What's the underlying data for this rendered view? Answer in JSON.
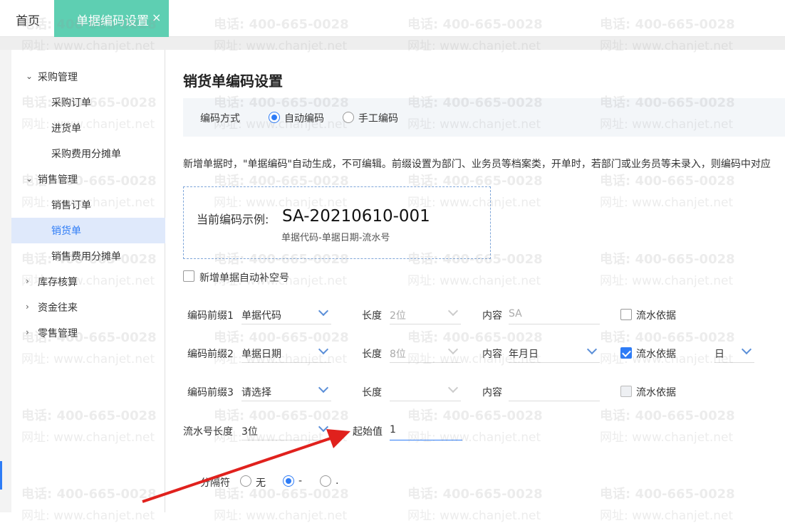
{
  "tabs": {
    "home": "首页",
    "active": "单据编码设置",
    "close": "×"
  },
  "sidebar": {
    "groups": [
      {
        "label": "采购管理",
        "items": [
          "采购订单",
          "进货单",
          "采购费用分摊单"
        ]
      },
      {
        "label": "销售管理",
        "items": [
          "销售订单",
          "销货单",
          "销售费用分摊单"
        ]
      },
      {
        "label": "库存核算"
      },
      {
        "label": "资金往来"
      },
      {
        "label": "零售管理"
      }
    ],
    "active_item": "销货单"
  },
  "main": {
    "title": "销货单编码设置",
    "mode": {
      "label": "编码方式",
      "auto": "自动编码",
      "manual": "手工编码",
      "selected": "自动编码"
    },
    "description": "新增单据时，\"单据编码\"自动生成，不可编辑。前缀设置为部门、业务员等档案类，开单时，若部门或业务员等未录入，则编码中对应",
    "example": {
      "label": "当前编码示例:",
      "code": "SA-20210610-001",
      "format": "单据代码-单据日期-流水号"
    },
    "auto_fill_label": "新增单据自动补空号",
    "prefix_rows": [
      {
        "label": "编码前缀1",
        "type": "单据代码",
        "length_label": "长度",
        "length": "2位",
        "content_label": "内容",
        "content": "SA",
        "serial_label": "流水依据",
        "serial_checked": false
      },
      {
        "label": "编码前缀2",
        "type": "单据日期",
        "length_label": "长度",
        "length": "8位",
        "content_label": "内容",
        "content": "年月日",
        "serial_label": "流水依据",
        "serial_checked": true,
        "serial_unit": "日"
      },
      {
        "label": "编码前缀3",
        "type": "请选择",
        "length_label": "长度",
        "length": "",
        "content_label": "内容",
        "content": "",
        "serial_label": "流水依据",
        "serial_checked": false
      }
    ],
    "serial": {
      "length_label": "流水号长度",
      "length": "3位",
      "start_label": "起始值",
      "start": "1"
    },
    "separator": {
      "label": "分隔符",
      "options": [
        "无",
        "-",
        "."
      ],
      "selected": "-"
    }
  },
  "watermark": {
    "phone": "电话: 400-665-0028",
    "site": "网址: www.chanjet.net"
  },
  "colors": {
    "accent": "#2e7cf6",
    "tab": "#5ecfb2",
    "arrow": "#e0211d"
  }
}
